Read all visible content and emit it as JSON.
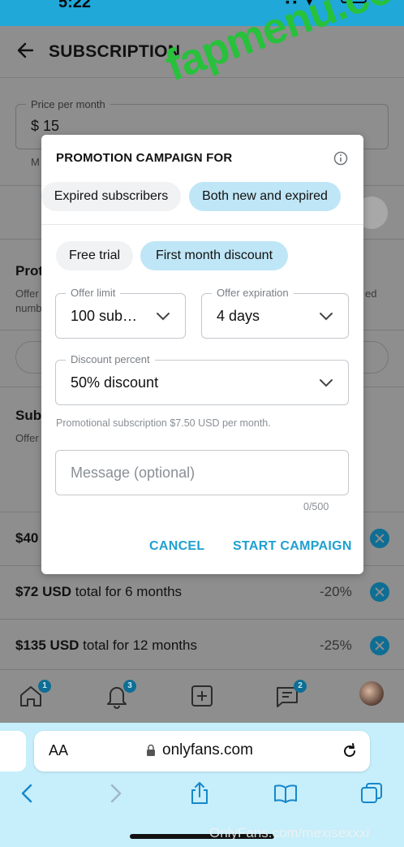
{
  "status": {
    "time": "5:22"
  },
  "header": {
    "title": "SUBSCRIPTION"
  },
  "background": {
    "price_label": "Price per month",
    "price_value": "$ 15",
    "frag_m": "M",
    "frag_prot": "Prot",
    "frag_offer1": "Offer",
    "frag_numb": "numb",
    "frag_ed": "ed",
    "frag_sub": "Sub",
    "frag_offer2": "Offer",
    "frag_40": "$40"
  },
  "bundles": [
    {
      "price": "$72 USD",
      "desc": " total for 6 months",
      "discount": "-20%"
    },
    {
      "price": "$135 USD",
      "desc": " total for 12 months",
      "discount": "-25%"
    }
  ],
  "nav": {
    "home_badge": "1",
    "notif_badge": "3",
    "msg_badge": "2"
  },
  "modal": {
    "title": "PROMOTION CAMPAIGN FOR",
    "audience": {
      "expired": "Expired subscribers",
      "both": "Both new and expired"
    },
    "type": {
      "free_trial": "Free trial",
      "discount": "First month discount"
    },
    "offer_limit": {
      "label": "Offer limit",
      "value": "100 sub…"
    },
    "offer_expiration": {
      "label": "Offer expiration",
      "value": "4 days"
    },
    "discount_percent": {
      "label": "Discount percent",
      "value": "50% discount"
    },
    "helper": "Promotional subscription $7.50 USD per month.",
    "message_placeholder": "Message (optional)",
    "counter": "0/500",
    "cancel": "CANCEL",
    "start": "START CAMPAIGN"
  },
  "watermark": {
    "main": "fapmenu.com",
    "footer": "OnlyFans.com/mexisexxxi"
  },
  "browser": {
    "aa": "AA",
    "url": "onlyfans.com"
  },
  "colors": {
    "accent": "#1fa0d0",
    "chip_selected": "#bfe6f6",
    "status_bar": "#1fa8d8",
    "browser_bg": "#c6eefb"
  }
}
